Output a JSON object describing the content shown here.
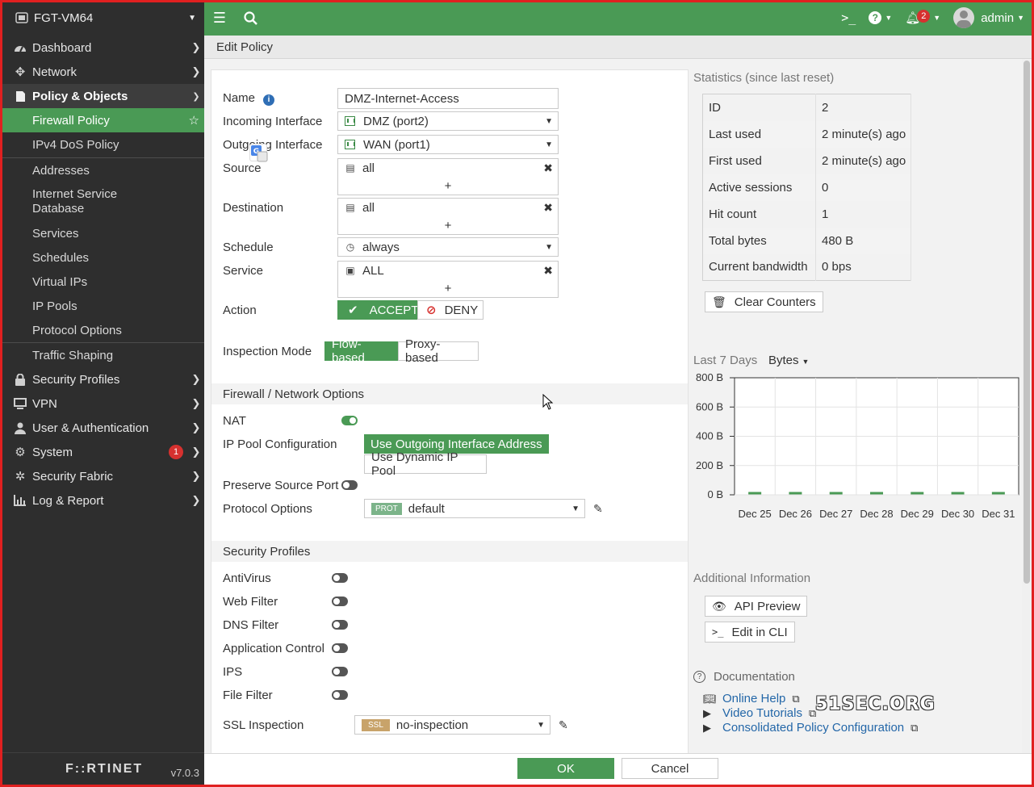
{
  "app": {
    "device_name": "FGT-VM64",
    "version": "v7.0.3",
    "brand": "F::RTINET",
    "page_title": "Edit Policy",
    "accent_color": "#4a9a55"
  },
  "topbar": {
    "notification_count": "2",
    "user": "admin"
  },
  "sidebar": {
    "items": [
      {
        "label": "Dashboard",
        "icon": "gauge-icon"
      },
      {
        "label": "Network",
        "icon": "network-icon"
      },
      {
        "label": "Policy & Objects",
        "icon": "policy-icon"
      },
      {
        "label": "Security Profiles",
        "icon": "lock-icon"
      },
      {
        "label": "VPN",
        "icon": "monitor-icon"
      },
      {
        "label": "User & Authentication",
        "icon": "user-icon"
      },
      {
        "label": "System",
        "icon": "gear-icon",
        "badge": "1"
      },
      {
        "label": "Security Fabric",
        "icon": "fabric-icon"
      },
      {
        "label": "Log & Report",
        "icon": "chart-icon"
      }
    ],
    "policy_sub": [
      "Firewall Policy",
      "IPv4 DoS Policy",
      "Addresses",
      "Internet Service Database",
      "Services",
      "Schedules",
      "Virtual IPs",
      "IP Pools",
      "Protocol Options",
      "Traffic Shaping"
    ]
  },
  "form": {
    "labels": {
      "name": "Name",
      "incoming": "Incoming Interface",
      "outgoing": "Outgoing Interface",
      "source": "Source",
      "destination": "Destination",
      "schedule": "Schedule",
      "service": "Service",
      "action": "Action",
      "inspection_mode": "Inspection Mode"
    },
    "values": {
      "name": "DMZ-Internet-Access",
      "incoming": "DMZ (port2)",
      "outgoing": "WAN (port1)",
      "source": "all",
      "destination": "all",
      "schedule": "always",
      "service": "ALL"
    },
    "add_symbol": "+",
    "action_accept": "ACCEPT",
    "action_deny": "DENY",
    "mode_flow": "Flow-based",
    "mode_proxy": "Proxy-based",
    "fw_section": "Firewall / Network Options",
    "nat": "NAT",
    "ip_pool": "IP Pool Configuration",
    "pool_outgoing": "Use Outgoing Interface Address",
    "pool_dynamic": "Use Dynamic IP Pool",
    "preserve_port": "Preserve Source Port",
    "protocol_options": "Protocol Options",
    "protocol_tag": "PROT",
    "protocol_value": "default",
    "sp_section": "Security Profiles",
    "profiles": [
      "AntiVirus",
      "Web Filter",
      "DNS Filter",
      "Application Control",
      "IPS",
      "File Filter"
    ],
    "ssl_label": "SSL Inspection",
    "ssl_tag": "SSL",
    "ssl_value": "no-inspection"
  },
  "stats": {
    "title": "Statistics (since last reset)",
    "rows": [
      {
        "k": "ID",
        "v": "2"
      },
      {
        "k": "Last used",
        "v": "2 minute(s) ago"
      },
      {
        "k": "First used",
        "v": "2 minute(s) ago"
      },
      {
        "k": "Active sessions",
        "v": "0"
      },
      {
        "k": "Hit count",
        "v": "1"
      },
      {
        "k": "Total bytes",
        "v": "480 B"
      },
      {
        "k": "Current bandwidth",
        "v": "0 bps"
      }
    ],
    "clear_button": "Clear Counters"
  },
  "chart_data": {
    "type": "line",
    "title": "Last 7 Days",
    "metric_selector": "Bytes",
    "categories": [
      "Dec 25",
      "Dec 26",
      "Dec 27",
      "Dec 28",
      "Dec 29",
      "Dec 30",
      "Dec 31"
    ],
    "values": [
      0,
      0,
      0,
      0,
      0,
      0,
      0
    ],
    "yticks": [
      "800 B",
      "600 B",
      "400 B",
      "200 B",
      "0 B"
    ],
    "ylim": [
      0,
      800
    ],
    "series_color": "#4a9a55",
    "grid": true
  },
  "additional": {
    "title": "Additional Information",
    "api_preview": "API Preview",
    "edit_cli": "Edit in CLI",
    "doc_title": "Documentation",
    "links": [
      "Online Help",
      "Video Tutorials",
      "Consolidated Policy Configuration"
    ]
  },
  "footer": {
    "ok": "OK",
    "cancel": "Cancel"
  },
  "watermark": "51SEC.ORG"
}
